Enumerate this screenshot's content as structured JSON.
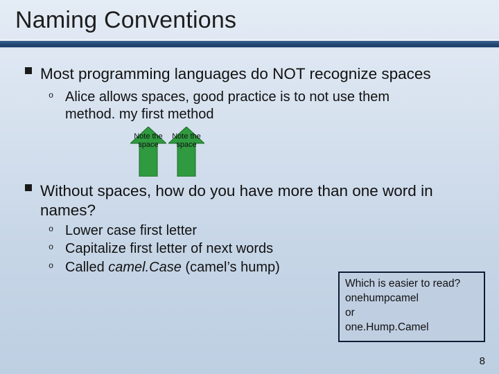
{
  "title": "Naming Conventions",
  "section1": {
    "bullet": "Most programming languages do NOT recognize spaces",
    "sub1_line1": "Alice allows spaces, good practice is to not use them",
    "sub1_line2": "method. my first method",
    "arrow_label": "Note the space"
  },
  "section2": {
    "bullet": "Without spaces, how do you have more than one word in names?",
    "sub1": "Lower case first letter",
    "sub2": "Capitalize first letter of next words",
    "sub3_prefix": "Called ",
    "sub3_em": "camel.Case",
    "sub3_suffix": " (camel’s hump)"
  },
  "callout": {
    "line1": "Which is easier to read?",
    "line2": "onehumpcamel",
    "line3": "or",
    "line4": "one.Hump.Camel"
  },
  "page_number": "8"
}
